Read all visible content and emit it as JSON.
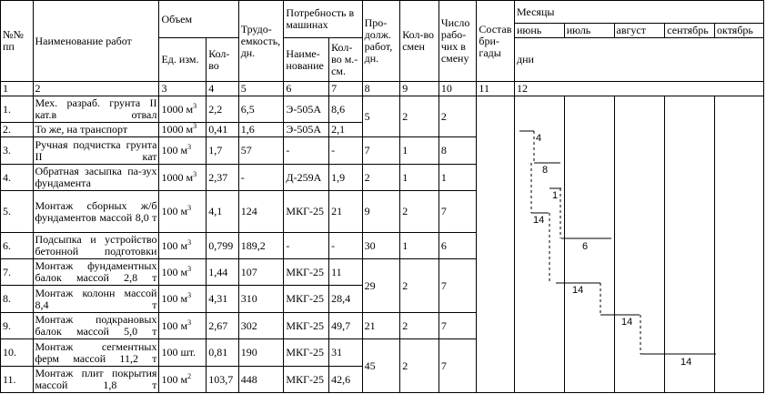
{
  "headers": {
    "num": "№№ пп",
    "name": "Наименование работ",
    "volume": "Объем",
    "vol_unit": "Ед. изм.",
    "vol_qty": "Кол-во",
    "labor": "Трудо-емкость, дн.",
    "machines": "Потребность в машинах",
    "mach_name": "Наиме-нование",
    "mach_qty": "Кол-во м.-см.",
    "duration": "Про-долж. работ, дн.",
    "shifts": "Кол-во смен",
    "workers": "Число рабо-чих в смену",
    "brigade": "Состав бри-гады",
    "months_title": "Месяцы",
    "months": [
      "июнь",
      "июль",
      "август",
      "сентябрь",
      "октябрь"
    ],
    "days": "дни"
  },
  "col_numbers": [
    "1",
    "2",
    "3",
    "4",
    "5",
    "6",
    "7",
    "8",
    "9",
    "10",
    "11",
    "12"
  ],
  "rows": [
    {
      "n": "1.",
      "name": "Мех. разраб. грунта II кат.в отвал",
      "unit": "1000 м",
      "qty": "2,2",
      "labor": "6,5",
      "mach": "Э-505А",
      "mqty": "8,6"
    },
    {
      "n": "2.",
      "name": "То же, на транспорт",
      "unit": "1000 м",
      "qty": "0,41",
      "labor": "1,6",
      "mach": "Э-505А",
      "mqty": "2,1"
    },
    {
      "n": "3.",
      "name": "Ручная подчистка грунта II кат",
      "unit": "100 м",
      "qty": "1,7",
      "labor": "57",
      "mach": "-",
      "mqty": "-"
    },
    {
      "n": "4.",
      "name": "Обратная засыпка па-зух фундамента",
      "unit": "1000 м",
      "qty": "2,37",
      "labor": "-",
      "mach": "Д-259А",
      "mqty": "1,9"
    },
    {
      "n": "5.",
      "name": "Монтаж сборных ж/б фундаментов массой 8,0 т",
      "unit": "100 м",
      "qty": "4,1",
      "labor": "124",
      "mach": "МКГ-25",
      "mqty": "21"
    },
    {
      "n": "6.",
      "name": "Подсыпка и устройство бетонной подготовки",
      "unit": "100 м",
      "qty": "0,799",
      "labor": "189,2",
      "mach": "-",
      "mqty": "-"
    },
    {
      "n": "7.",
      "name": "Монтаж фундаментных балок массой 2,8 т",
      "unit": "100 м",
      "qty": "1,44",
      "labor": "107",
      "mach": "МКГ-25",
      "mqty": "11"
    },
    {
      "n": "8.",
      "name": "Монтаж колонн массой 8,4 т",
      "unit": "100 м",
      "qty": "4,31",
      "labor": "310",
      "mach": "МКГ-25",
      "mqty": "28,4"
    },
    {
      "n": "9.",
      "name": "Монтаж подкрановых балок массой 5,0 т",
      "unit": "100 м",
      "qty": "2,67",
      "labor": "302",
      "mach": "МКГ-25",
      "mqty": "49,7"
    },
    {
      "n": "10.",
      "name": "Монтаж сегментных ферм массой 11,2 т",
      "unit": "100 шт.",
      "qty": "0,81",
      "labor": "190",
      "mach": "МКГ-25",
      "mqty": "31"
    },
    {
      "n": "11.",
      "name": "Монтаж плит покрытия массой 1,8 т",
      "unit": "100 м",
      "qty": "103,7",
      "labor": "448",
      "mach": "МКГ-25",
      "mqty": "42,6"
    }
  ],
  "sup": [
    "3",
    "3",
    "3",
    "3",
    "3",
    "3",
    "3",
    "3",
    "3",
    "",
    "2"
  ],
  "groups": [
    {
      "dur": "5",
      "shifts": "2",
      "workers": "2"
    },
    {
      "dur": "7",
      "shifts": "1",
      "workers": "8"
    },
    {
      "dur": "2",
      "shifts": "1",
      "workers": "1"
    },
    {
      "dur": "9",
      "shifts": "2",
      "workers": "7"
    },
    {
      "dur": "30",
      "shifts": "1",
      "workers": "6"
    },
    {
      "dur": "29",
      "shifts": "2",
      "workers": "7"
    },
    {
      "dur": "21",
      "shifts": "2",
      "workers": "7"
    },
    {
      "dur": "45",
      "shifts": "2",
      "workers": "7"
    }
  ],
  "gantt_labels": [
    "4",
    "8",
    "1",
    "14",
    "6",
    "14",
    "14",
    "14"
  ]
}
